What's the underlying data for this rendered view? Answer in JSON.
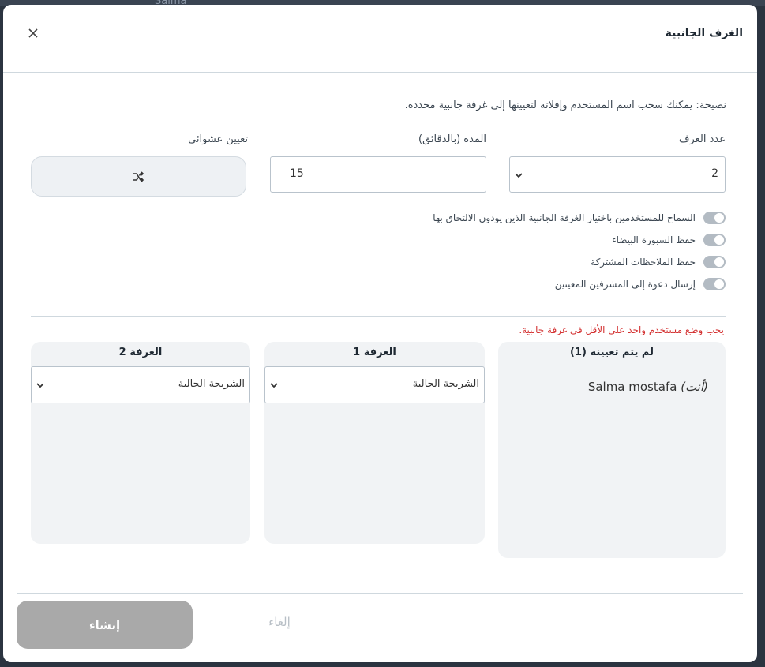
{
  "backdrop": {
    "user_name": "Salma"
  },
  "dialog": {
    "title": "الغرف الجانبية",
    "tip": "نصيحة: يمكنك سحب اسم المستخدم وإفلاته لتعيينها إلى غرفة جانبية محددة.",
    "fields": {
      "room_count": {
        "label": "عدد الغرف",
        "value": "2"
      },
      "duration": {
        "label": "المدة (بالدقائق)",
        "value": "15"
      },
      "random_assign": {
        "label": "تعيين عشوائي",
        "icon": "shuffle-icon"
      }
    },
    "toggles": [
      {
        "label": "السماح للمستخدمين باختيار الغرفة الجانبية الذين يودون الالتحاق بها",
        "on": false
      },
      {
        "label": "حفظ السبورة البيضاء",
        "on": false
      },
      {
        "label": "حفظ الملاحظات المشتركة",
        "on": false
      },
      {
        "label": "إرسال دعوة إلى المشرفين المعينين",
        "on": false
      }
    ],
    "error": "يجب وضع مستخدم واحد على الأقل في غرفة جانبية.",
    "unassigned": {
      "title": "لم يتم تعيينه (1)",
      "users": [
        {
          "name": "Salma mostafa",
          "you_label": "(أنت)"
        }
      ]
    },
    "rooms": [
      {
        "title": "الغرفة 1",
        "select_value": "الشريحة الحالية"
      },
      {
        "title": "الغرفة 2",
        "select_value": "الشريحة الحالية"
      }
    ],
    "buttons": {
      "create": "إنشاء",
      "cancel": "إلغاء"
    }
  },
  "colors": {
    "error": "#d32f2f",
    "button_disabled": "#a9a9a9",
    "panel_bg": "#f1f3f5"
  }
}
